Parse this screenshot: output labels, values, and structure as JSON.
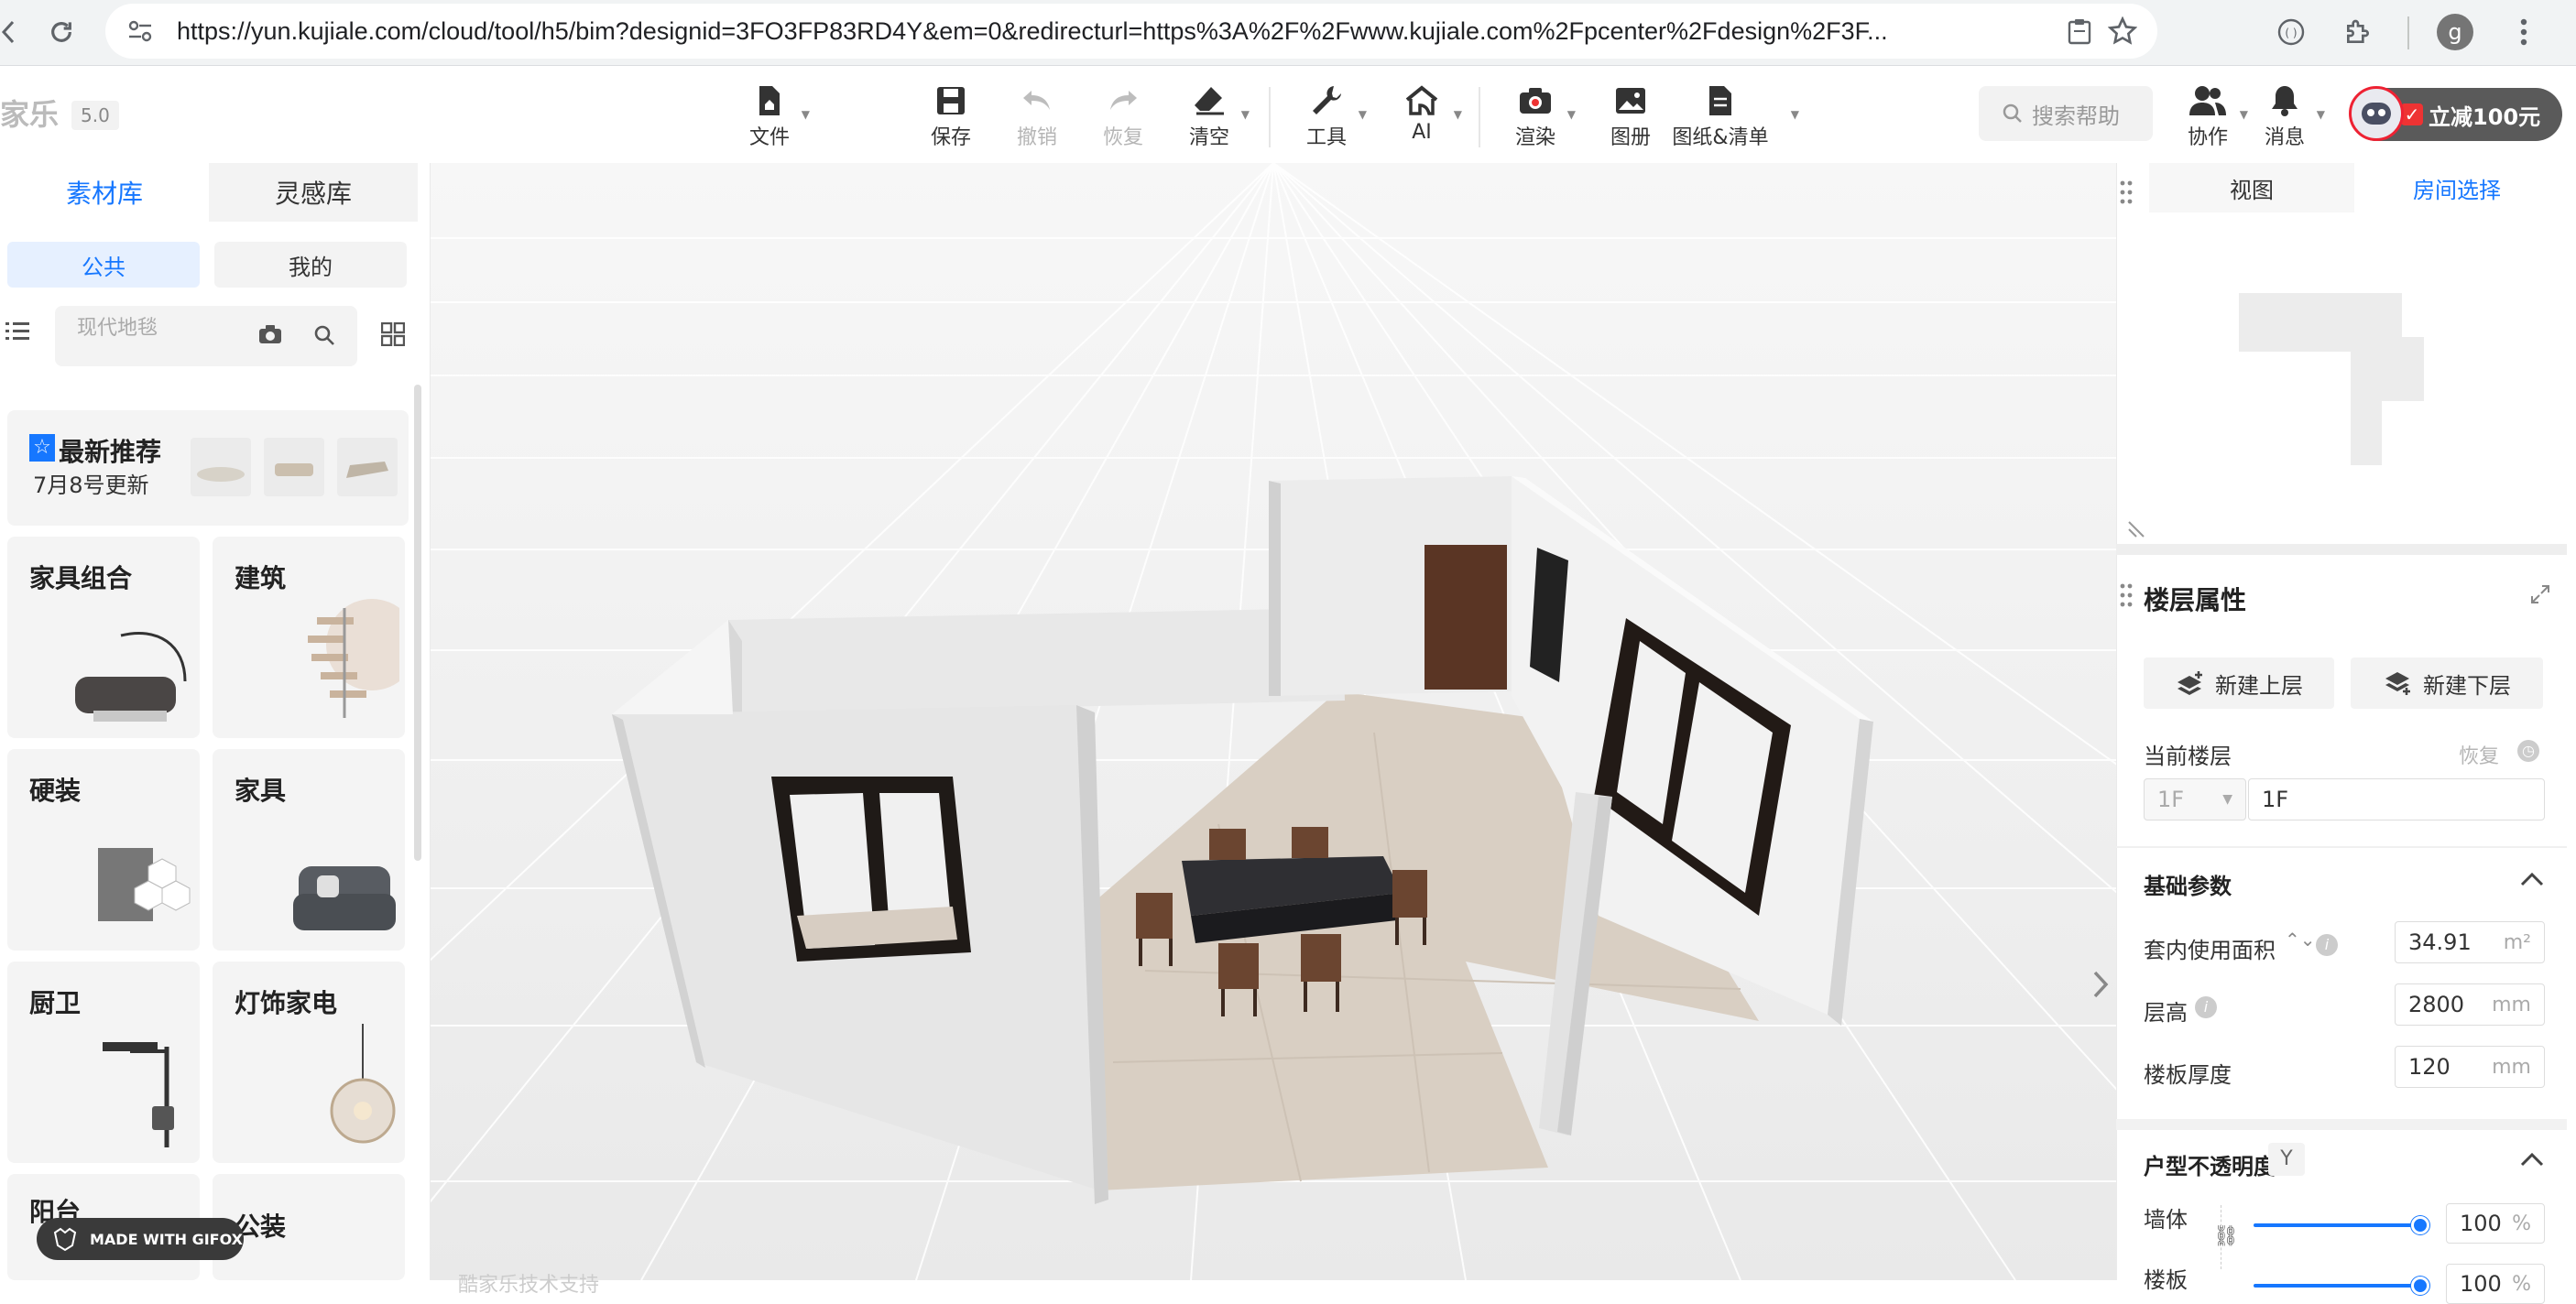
{
  "browser": {
    "url": "https://yun.kujiale.com/cloud/tool/h5/bim?designid=3FO3FP83RD4Y&em=0&redirecturl=https%3A%2F%2Fwww.kujiale.com%2Fpcenter%2Fdesign%2F3F...",
    "profile_initial": "g"
  },
  "app": {
    "logo": "家乐",
    "version": "5.0",
    "toolbar": [
      {
        "label": "文件",
        "icon": "file-icon",
        "caret": true
      },
      {
        "label": "保存",
        "icon": "save-icon",
        "caret": false
      },
      {
        "label": "撤销",
        "icon": "undo-icon",
        "caret": false,
        "disabled": true
      },
      {
        "label": "恢复",
        "icon": "redo-icon",
        "caret": false,
        "disabled": true
      },
      {
        "label": "清空",
        "icon": "eraser-icon",
        "caret": true
      },
      {
        "label": "工具",
        "icon": "wrench-icon",
        "caret": true
      },
      {
        "label": "AI",
        "icon": "ai-house-icon",
        "caret": true
      },
      {
        "label": "渲染",
        "icon": "camera-icon",
        "caret": true
      },
      {
        "label": "图册",
        "icon": "album-icon",
        "caret": false
      },
      {
        "label": "图纸&清单",
        "icon": "drawing-icon",
        "caret": true
      }
    ],
    "search_help": "搜索帮助",
    "collab": "协作",
    "messages": "消息",
    "promo": "立减100元"
  },
  "left_panel": {
    "tabs": [
      "素材库",
      "灵感库"
    ],
    "segments": [
      "公共",
      "我的"
    ],
    "search_placeholder": "现代地毯",
    "recommend": {
      "title": "最新推荐",
      "subtitle": "7月8号更新"
    },
    "categories": [
      "家具组合",
      "建筑",
      "硬装",
      "家具",
      "厨卫",
      "灯饰家电",
      "阳台",
      "公装"
    ],
    "gifox": "MADE WITH GIFOX"
  },
  "viewport": {
    "watermark": "酷家乐技术支持"
  },
  "right_panel": {
    "tabs": [
      "视图",
      "房间选择"
    ],
    "floor_props": {
      "title": "楼层属性",
      "new_upper": "新建上层",
      "new_lower": "新建下层",
      "current_floor_label": "当前楼层",
      "restore": "恢复",
      "floor_select": "1F",
      "floor_name": "1F"
    },
    "basic": {
      "title": "基础参数",
      "area_label": "套内使用面积",
      "area_value": "34.91",
      "area_unit": "m²",
      "height_label": "层高",
      "height_value": "2800",
      "height_unit": "mm",
      "slab_label": "楼板厚度",
      "slab_value": "120",
      "slab_unit": "mm"
    },
    "opacity": {
      "title": "户型不透明度",
      "badge": "Y",
      "wall_label": "墙体",
      "wall_value": "100",
      "slab_label": "楼板",
      "slab_value": "100",
      "unit": "%",
      "wall_level": 1.0,
      "slab_level": 1.0
    }
  },
  "colors": {
    "accent": "#1677ff",
    "promo_red": "#e62e2e"
  }
}
